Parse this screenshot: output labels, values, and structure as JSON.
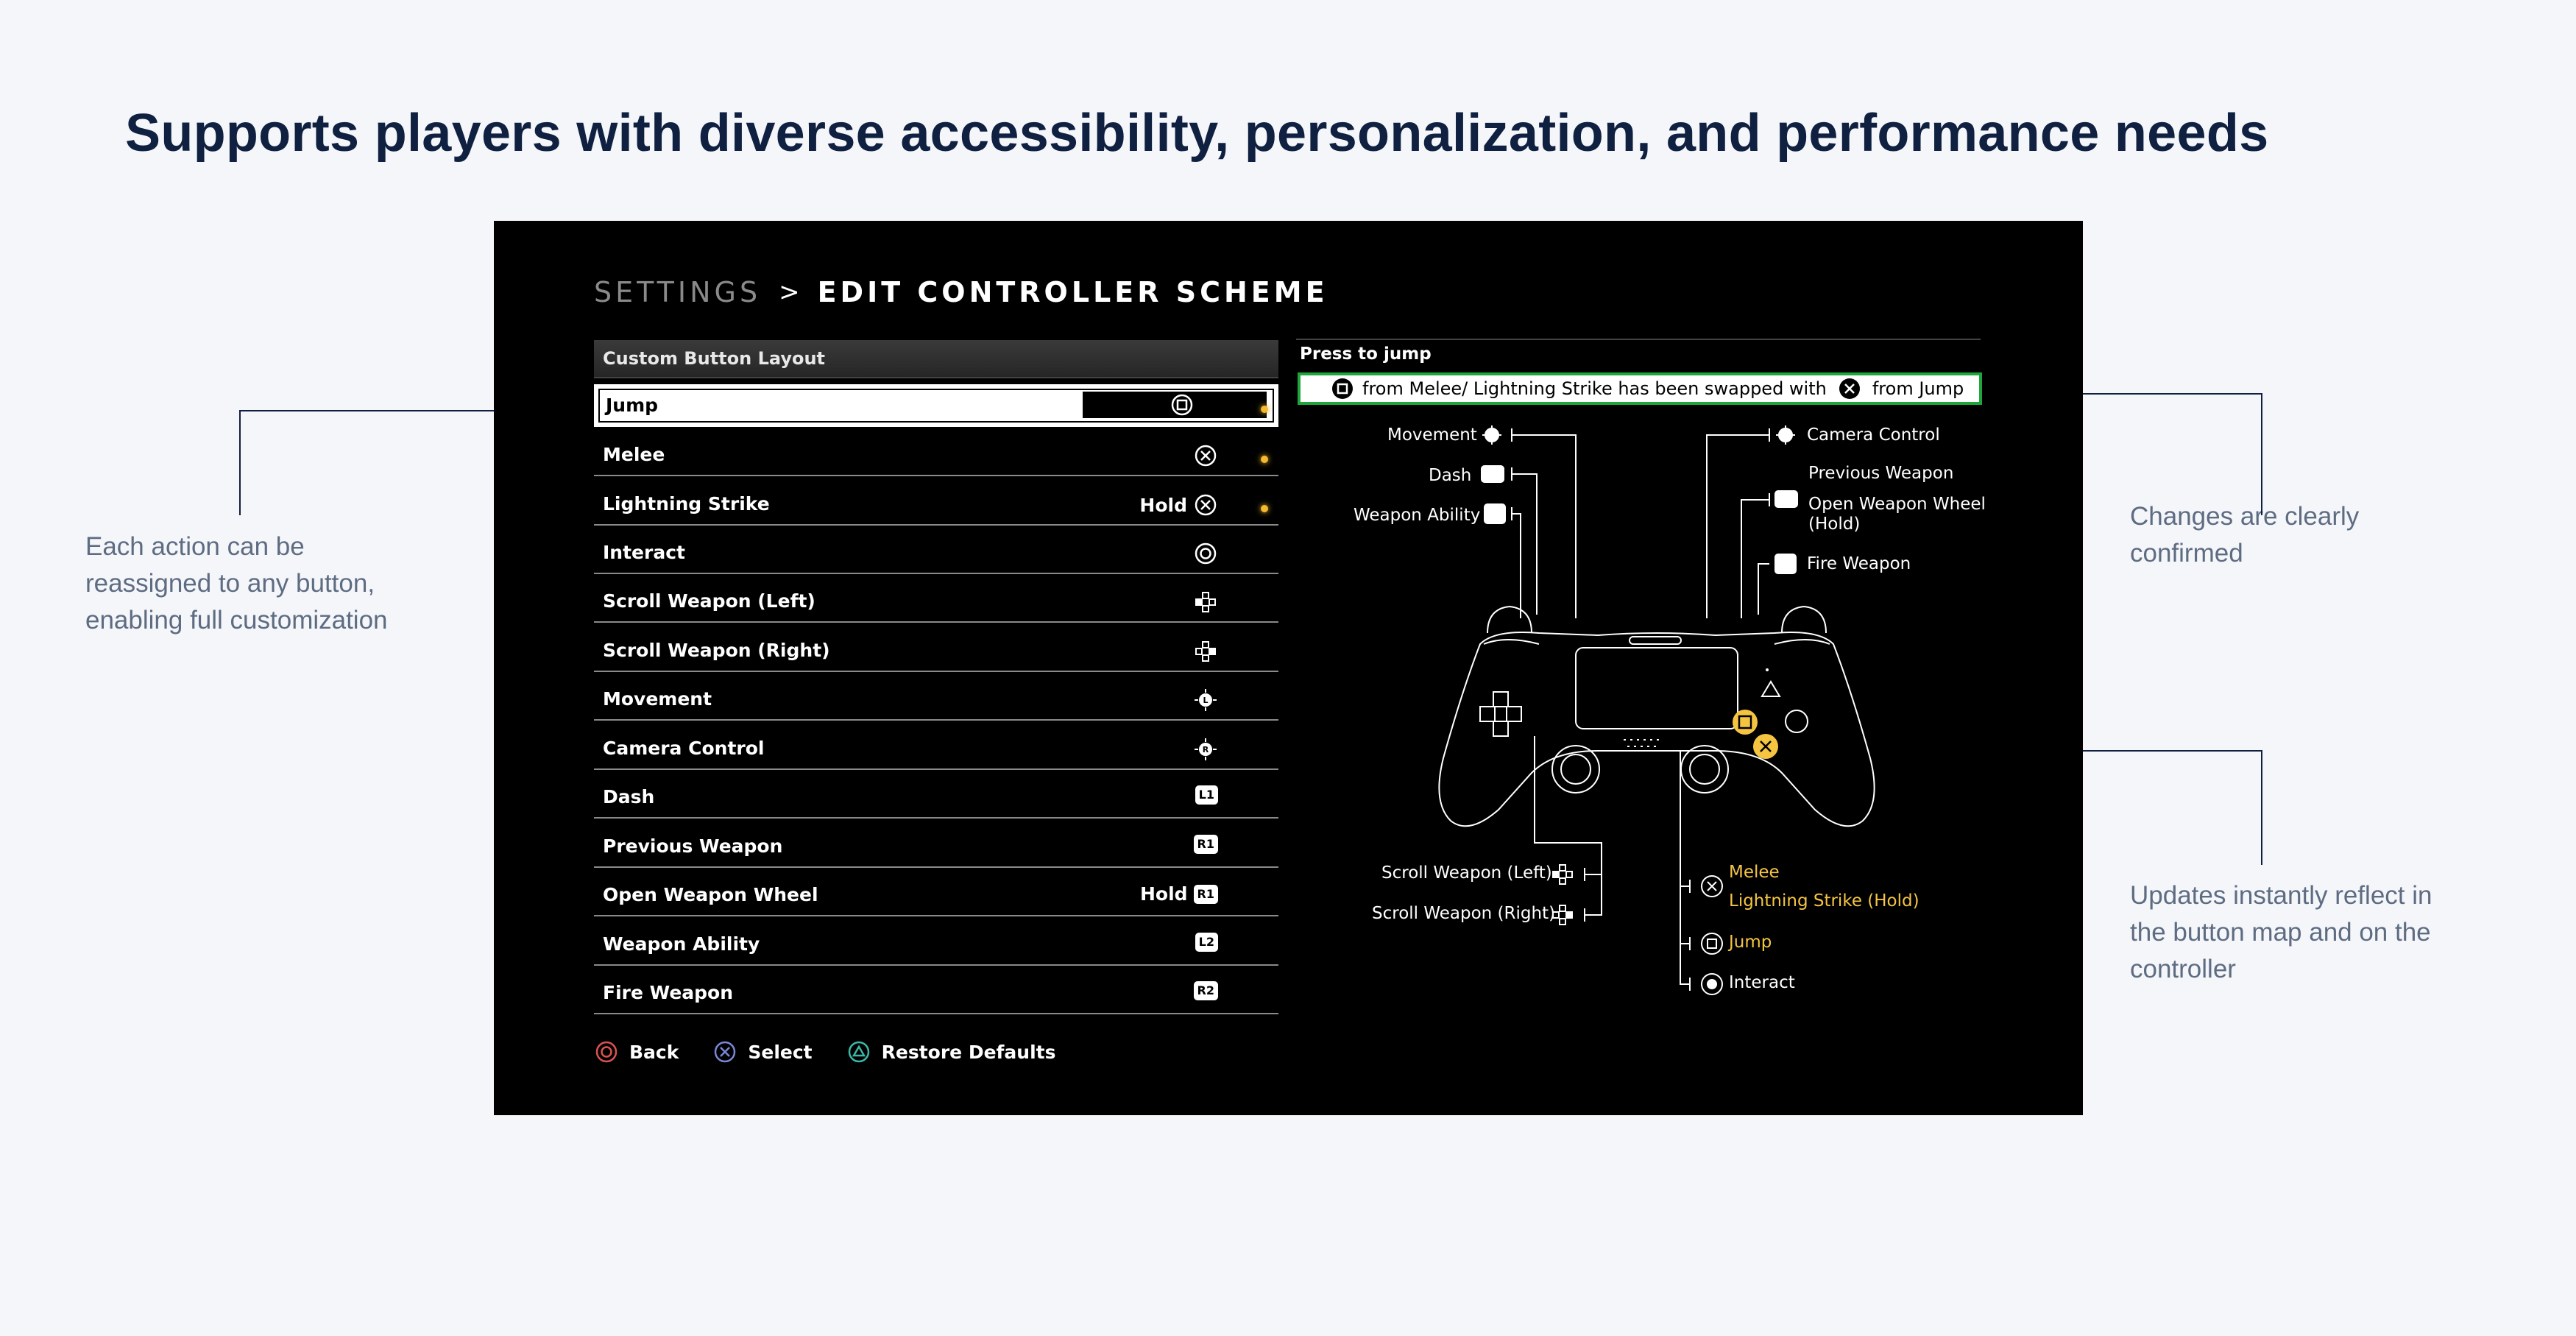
{
  "headline": "Supports players with diverse accessibility, personalization, and performance needs",
  "notes": {
    "left": "Each action can be reassigned to any button, enabling full customization",
    "right_top": "Changes are clearly confirmed",
    "right_bottom": "Updates instantly reflect in the button map and on the controller"
  },
  "breadcrumb": {
    "parent": "SETTINGS",
    "separator": ">",
    "current": "EDIT CONTROLLER SCHEME"
  },
  "layout_header": "Custom Button Layout",
  "bindings": [
    {
      "action": "Jump",
      "hold": "",
      "icon": "square-button-icon",
      "selected": true,
      "changed": true
    },
    {
      "action": "Melee",
      "hold": "",
      "icon": "cross-button-icon",
      "selected": false,
      "changed": true
    },
    {
      "action": "Lightning Strike",
      "hold": "Hold",
      "icon": "cross-button-icon",
      "selected": false,
      "changed": true
    },
    {
      "action": "Interact",
      "hold": "",
      "icon": "circle-button-icon",
      "selected": false,
      "changed": false
    },
    {
      "action": "Scroll Weapon (Left)",
      "hold": "",
      "icon": "dpad-left-icon",
      "selected": false,
      "changed": false
    },
    {
      "action": "Scroll Weapon (Right)",
      "hold": "",
      "icon": "dpad-right-icon",
      "selected": false,
      "changed": false
    },
    {
      "action": "Movement",
      "hold": "",
      "icon": "left-stick-icon",
      "selected": false,
      "changed": false
    },
    {
      "action": "Camera Control",
      "hold": "",
      "icon": "right-stick-icon",
      "selected": false,
      "changed": false
    },
    {
      "action": "Dash",
      "hold": "",
      "icon": "l1-button-icon",
      "tag": "L1",
      "selected": false,
      "changed": false
    },
    {
      "action": "Previous Weapon",
      "hold": "",
      "icon": "r1-button-icon",
      "tag": "R1",
      "selected": false,
      "changed": false
    },
    {
      "action": "Open Weapon Wheel",
      "hold": "Hold",
      "icon": "r1-button-icon",
      "tag": "R1",
      "selected": false,
      "changed": false
    },
    {
      "action": "Weapon Ability",
      "hold": "",
      "icon": "l2-button-icon",
      "tag": "L2",
      "selected": false,
      "changed": false
    },
    {
      "action": "Fire Weapon",
      "hold": "",
      "icon": "r2-button-icon",
      "tag": "R2",
      "selected": false,
      "changed": false
    }
  ],
  "footer": {
    "back": "Back",
    "select": "Select",
    "restore": "Restore Defaults"
  },
  "press_label": "Press to jump",
  "confirmation": {
    "part1": "from Melee/ Lightning Strike has been swapped with",
    "part2": "from Jump"
  },
  "controller_map": {
    "movement": "Movement",
    "dash": "Dash",
    "weapon_ability": "Weapon Ability",
    "camera_control": "Camera Control",
    "previous_weapon": "Previous Weapon",
    "open_weapon_wheel": "Open Weapon Wheel\n(Hold)",
    "fire_weapon": "Fire Weapon",
    "scroll_left": "Scroll Weapon (Left)",
    "scroll_right": "Scroll Weapon (Right)",
    "melee": "Melee",
    "lightning_strike": "Lightning Strike (Hold)",
    "jump": "Jump",
    "interact": "Interact"
  },
  "colors": {
    "accent_gold": "#f5c542",
    "confirm_green": "#1fa63a",
    "headline": "#0f2040",
    "note": "#5e6c82"
  }
}
